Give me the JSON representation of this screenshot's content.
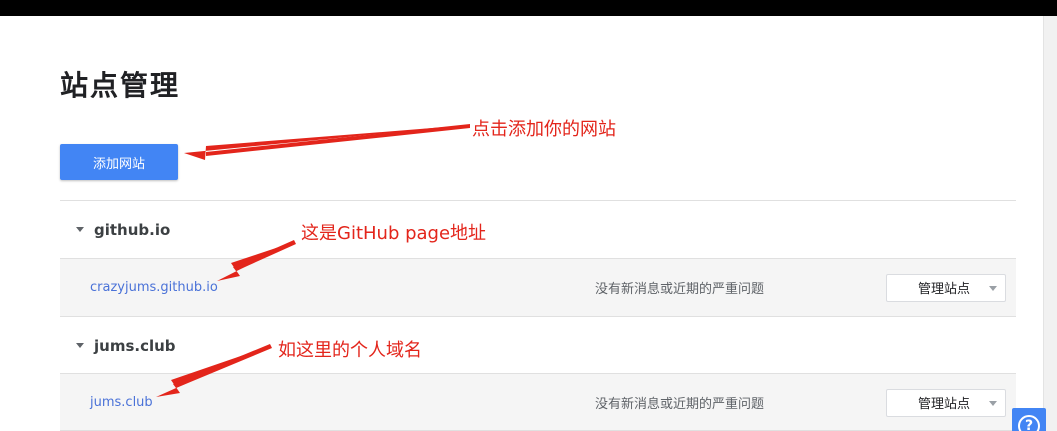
{
  "page": {
    "title": "站点管理",
    "add_site_button": "添加网站"
  },
  "groups": [
    {
      "name": "github.io",
      "site": {
        "url": "crazyjums.github.io",
        "status": "没有新消息或近期的严重问题",
        "manage_label": "管理站点"
      }
    },
    {
      "name": "jums.club",
      "site": {
        "url": "jums.club",
        "status": "没有新消息或近期的严重问题",
        "manage_label": "管理站点"
      }
    }
  ],
  "annotations": [
    "点击添加你的网站",
    "这是GitHub page地址",
    "如这里的个人域名"
  ],
  "colors": {
    "accent": "#4285f4",
    "link": "#4a72d8",
    "annotation": "#e3251b"
  },
  "icons": {
    "group_toggle": "caret-down-icon",
    "dropdown": "chevron-down-icon",
    "help": "help-icon"
  }
}
